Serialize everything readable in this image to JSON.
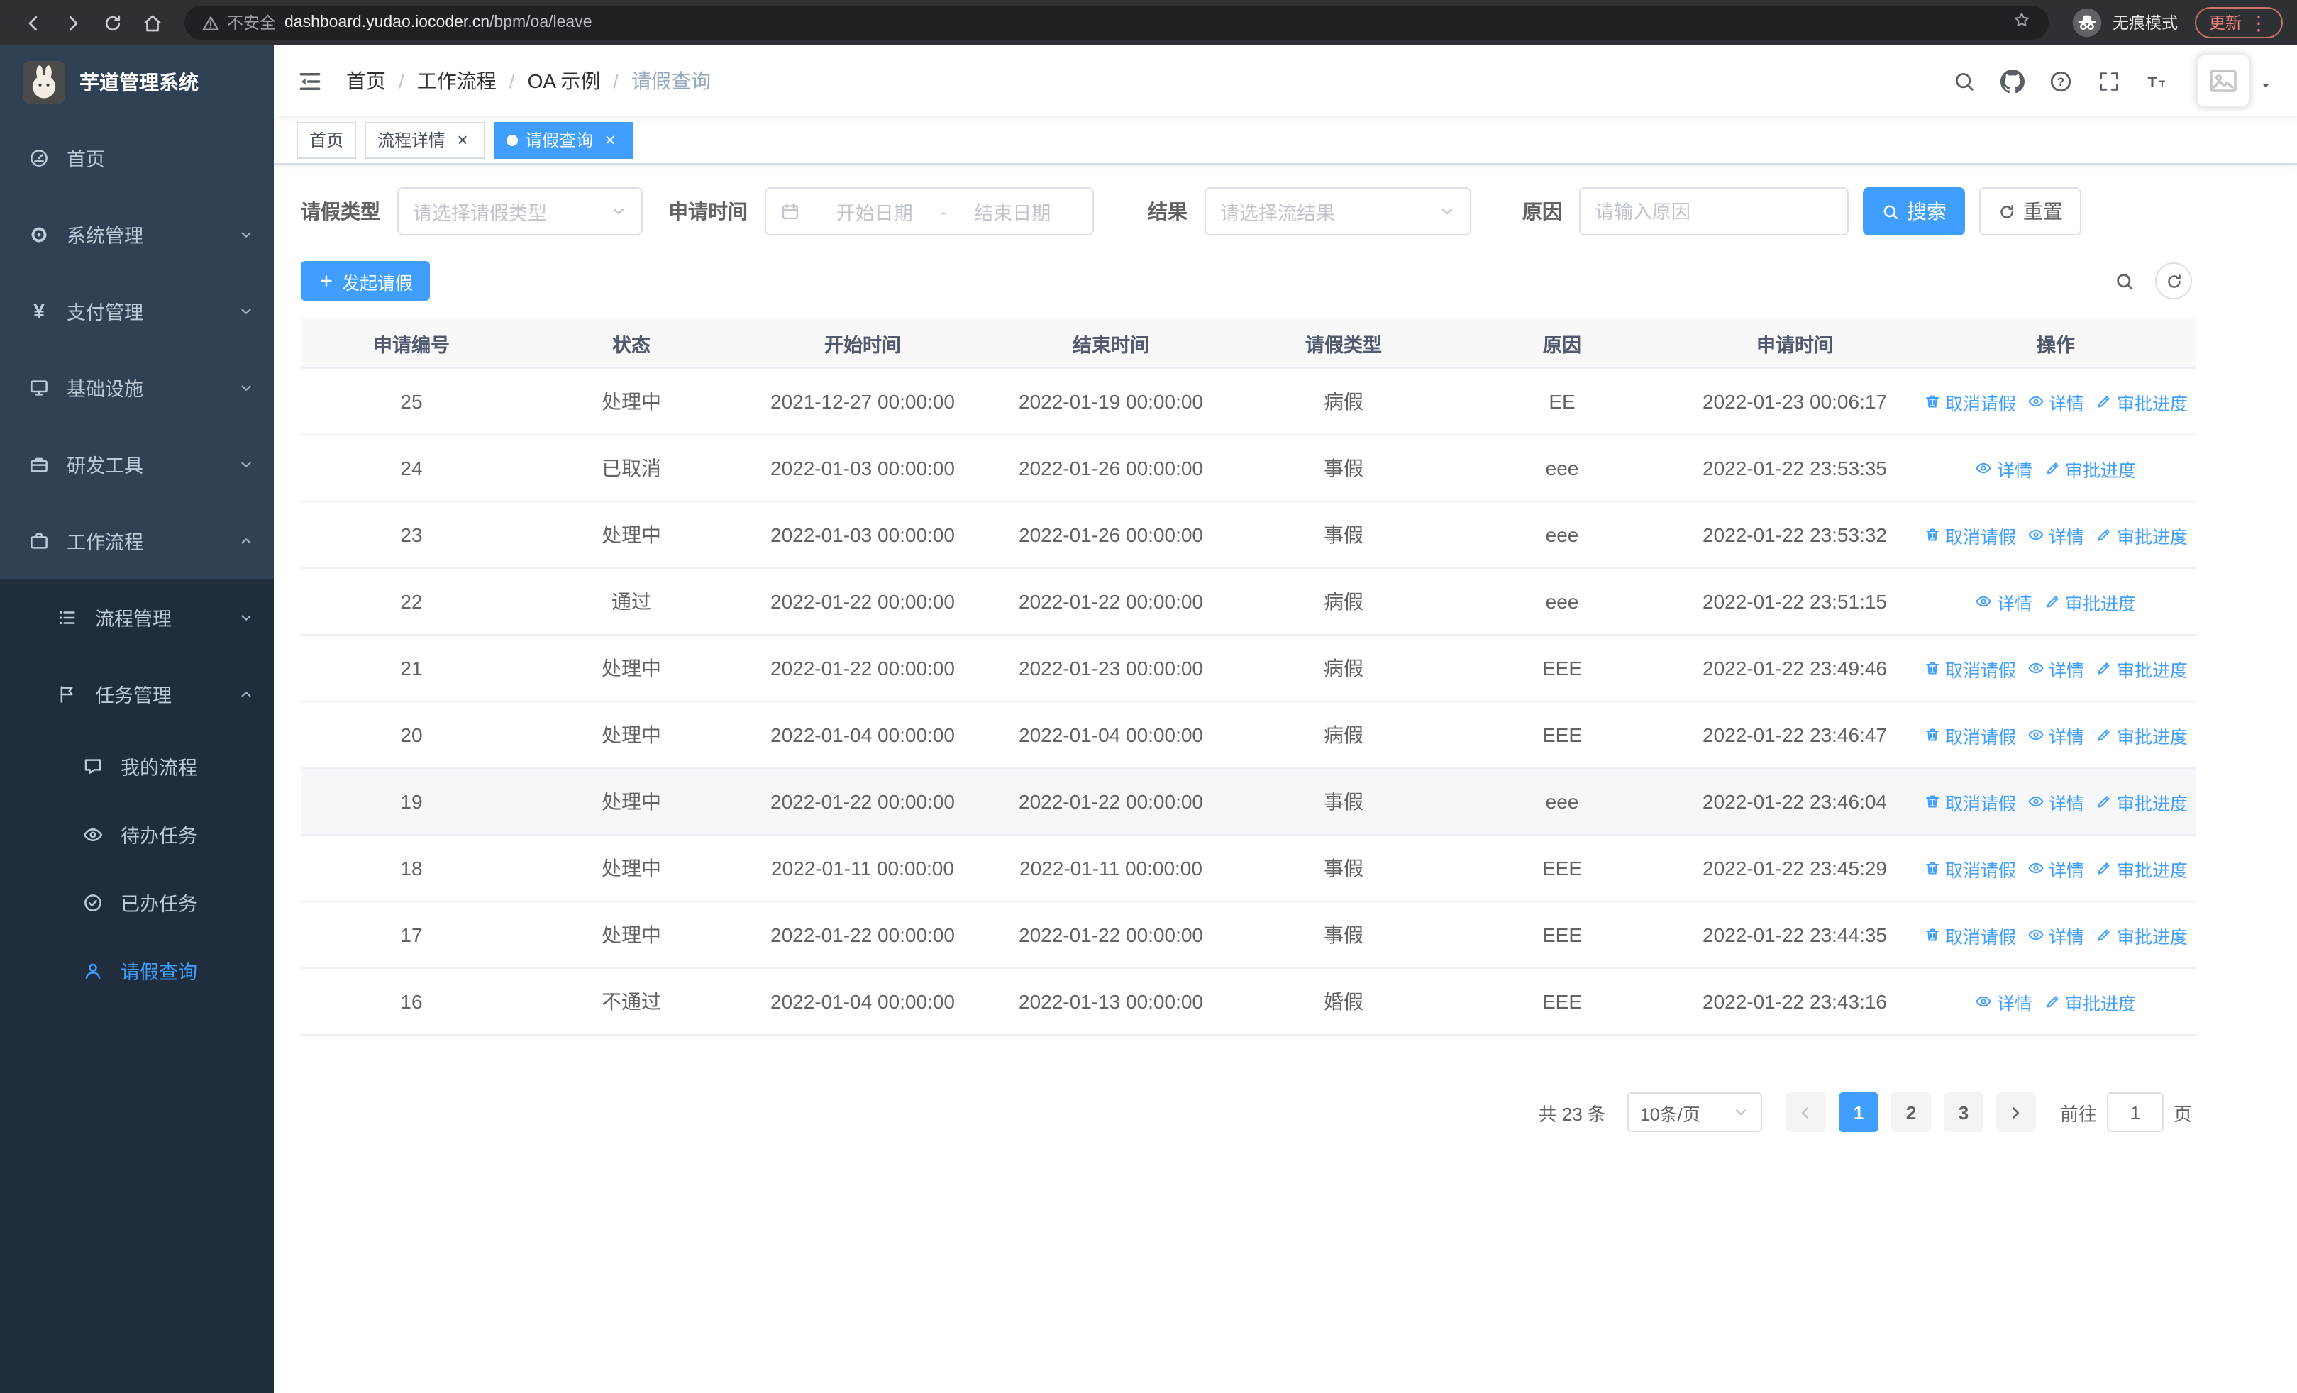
{
  "browser": {
    "security_label": "不安全",
    "url_host": "dashboard.yudao.iocoder.cn",
    "url_path": "/bpm/oa/leave",
    "incognito_label": "无痕模式",
    "update_label": "更新"
  },
  "sidebar": {
    "title": "芋道管理系统",
    "items": [
      {
        "key": "home",
        "label": "首页",
        "icon": "dashboard-icon",
        "level": 1
      },
      {
        "key": "system",
        "label": "系统管理",
        "icon": "gear-icon",
        "level": 1,
        "chevron": "down"
      },
      {
        "key": "payment",
        "label": "支付管理",
        "icon": "yen-icon",
        "level": 1,
        "chevron": "down"
      },
      {
        "key": "infra",
        "label": "基础设施",
        "icon": "monitor-icon",
        "level": 1,
        "chevron": "down"
      },
      {
        "key": "devtools",
        "label": "研发工具",
        "icon": "toolbox-icon",
        "level": 1,
        "chevron": "down"
      },
      {
        "key": "workflow",
        "label": "工作流程",
        "icon": "briefcase-icon",
        "level": 1,
        "chevron": "up",
        "expanded": true
      },
      {
        "key": "process-mgmt",
        "label": "流程管理",
        "icon": "list-icon",
        "level": 2,
        "chevron": "down"
      },
      {
        "key": "task-mgmt",
        "label": "任务管理",
        "icon": "flag-icon",
        "level": 2,
        "chevron": "up",
        "expanded": true
      },
      {
        "key": "my-process",
        "label": "我的流程",
        "icon": "chat-icon",
        "level": 3
      },
      {
        "key": "todo-tasks",
        "label": "待办任务",
        "icon": "eye-icon",
        "level": 3
      },
      {
        "key": "done-tasks",
        "label": "已办任务",
        "icon": "check-circle-icon",
        "level": 3
      },
      {
        "key": "leave-query",
        "label": "请假查询",
        "icon": "user-icon",
        "level": 3,
        "active": true
      }
    ]
  },
  "header": {
    "breadcrumb": [
      "首页",
      "工作流程",
      "OA 示例",
      "请假查询"
    ],
    "separator": "/"
  },
  "tabs": [
    {
      "label": "首页",
      "closable": false,
      "active": false
    },
    {
      "label": "流程详情",
      "closable": true,
      "active": false
    },
    {
      "label": "请假查询",
      "closable": true,
      "active": true
    }
  ],
  "filters": {
    "leave_type_label": "请假类型",
    "leave_type_placeholder": "请选择请假类型",
    "apply_time_label": "申请时间",
    "start_placeholder": "开始日期",
    "range_separator": "-",
    "end_placeholder": "结束日期",
    "result_label": "结果",
    "result_placeholder": "请选择流结果",
    "reason_label": "原因",
    "reason_placeholder": "请输入原因",
    "search_label": "搜索",
    "reset_label": "重置"
  },
  "toolbar": {
    "create_label": "发起请假"
  },
  "table": {
    "columns": [
      "申请编号",
      "状态",
      "开始时间",
      "结束时间",
      "请假类型",
      "原因",
      "申请时间",
      "操作"
    ],
    "rows": [
      {
        "id": "25",
        "status": "处理中",
        "start": "2021-12-27 00:00:00",
        "end": "2022-01-19 00:00:00",
        "type": "病假",
        "reason": "EE",
        "apply_time": "2022-01-23 00:06:17",
        "actions": [
          {
            "label": "取消请假",
            "icon": "delete-icon",
            "name": "cancel-leave-link"
          },
          {
            "label": "详情",
            "icon": "eye-icon",
            "name": "detail-link"
          },
          {
            "label": "审批进度",
            "icon": "edit-icon",
            "name": "audit-progress-link"
          }
        ]
      },
      {
        "id": "24",
        "status": "已取消",
        "start": "2022-01-03 00:00:00",
        "end": "2022-01-26 00:00:00",
        "type": "事假",
        "reason": "eee",
        "apply_time": "2022-01-22 23:53:35",
        "actions": [
          {
            "label": "详情",
            "icon": "eye-icon",
            "name": "detail-link"
          },
          {
            "label": "审批进度",
            "icon": "edit-icon",
            "name": "audit-progress-link"
          }
        ]
      },
      {
        "id": "23",
        "status": "处理中",
        "start": "2022-01-03 00:00:00",
        "end": "2022-01-26 00:00:00",
        "type": "事假",
        "reason": "eee",
        "apply_time": "2022-01-22 23:53:32",
        "actions": [
          {
            "label": "取消请假",
            "icon": "delete-icon",
            "name": "cancel-leave-link"
          },
          {
            "label": "详情",
            "icon": "eye-icon",
            "name": "detail-link"
          },
          {
            "label": "审批进度",
            "icon": "edit-icon",
            "name": "audit-progress-link"
          }
        ]
      },
      {
        "id": "22",
        "status": "通过",
        "start": "2022-01-22 00:00:00",
        "end": "2022-01-22 00:00:00",
        "type": "病假",
        "reason": "eee",
        "apply_time": "2022-01-22 23:51:15",
        "actions": [
          {
            "label": "详情",
            "icon": "eye-icon",
            "name": "detail-link"
          },
          {
            "label": "审批进度",
            "icon": "edit-icon",
            "name": "audit-progress-link"
          }
        ]
      },
      {
        "id": "21",
        "status": "处理中",
        "start": "2022-01-22 00:00:00",
        "end": "2022-01-23 00:00:00",
        "type": "病假",
        "reason": "EEE",
        "apply_time": "2022-01-22 23:49:46",
        "actions": [
          {
            "label": "取消请假",
            "icon": "delete-icon",
            "name": "cancel-leave-link"
          },
          {
            "label": "详情",
            "icon": "eye-icon",
            "name": "detail-link"
          },
          {
            "label": "审批进度",
            "icon": "edit-icon",
            "name": "audit-progress-link"
          }
        ]
      },
      {
        "id": "20",
        "status": "处理中",
        "start": "2022-01-04 00:00:00",
        "end": "2022-01-04 00:00:00",
        "type": "病假",
        "reason": "EEE",
        "apply_time": "2022-01-22 23:46:47",
        "actions": [
          {
            "label": "取消请假",
            "icon": "delete-icon",
            "name": "cancel-leave-link"
          },
          {
            "label": "详情",
            "icon": "eye-icon",
            "name": "detail-link"
          },
          {
            "label": "审批进度",
            "icon": "edit-icon",
            "name": "audit-progress-link"
          }
        ]
      },
      {
        "id": "19",
        "status": "处理中",
        "start": "2022-01-22 00:00:00",
        "end": "2022-01-22 00:00:00",
        "type": "事假",
        "reason": "eee",
        "apply_time": "2022-01-22 23:46:04",
        "highlighted": true,
        "actions": [
          {
            "label": "取消请假",
            "icon": "delete-icon",
            "name": "cancel-leave-link"
          },
          {
            "label": "详情",
            "icon": "eye-icon",
            "name": "detail-link"
          },
          {
            "label": "审批进度",
            "icon": "edit-icon",
            "name": "audit-progress-link"
          }
        ]
      },
      {
        "id": "18",
        "status": "处理中",
        "start": "2022-01-11 00:00:00",
        "end": "2022-01-11 00:00:00",
        "type": "事假",
        "reason": "EEE",
        "apply_time": "2022-01-22 23:45:29",
        "actions": [
          {
            "label": "取消请假",
            "icon": "delete-icon",
            "name": "cancel-leave-link"
          },
          {
            "label": "详情",
            "icon": "eye-icon",
            "name": "detail-link"
          },
          {
            "label": "审批进度",
            "icon": "edit-icon",
            "name": "audit-progress-link"
          }
        ]
      },
      {
        "id": "17",
        "status": "处理中",
        "start": "2022-01-22 00:00:00",
        "end": "2022-01-22 00:00:00",
        "type": "事假",
        "reason": "EEE",
        "apply_time": "2022-01-22 23:44:35",
        "actions": [
          {
            "label": "取消请假",
            "icon": "delete-icon",
            "name": "cancel-leave-link"
          },
          {
            "label": "详情",
            "icon": "eye-icon",
            "name": "detail-link"
          },
          {
            "label": "审批进度",
            "icon": "edit-icon",
            "name": "audit-progress-link"
          }
        ]
      },
      {
        "id": "16",
        "status": "不通过",
        "start": "2022-01-04 00:00:00",
        "end": "2022-01-13 00:00:00",
        "type": "婚假",
        "reason": "EEE",
        "apply_time": "2022-01-22 23:43:16",
        "actions": [
          {
            "label": "详情",
            "icon": "eye-icon",
            "name": "detail-link"
          },
          {
            "label": "审批进度",
            "icon": "edit-icon",
            "name": "audit-progress-link"
          }
        ]
      }
    ]
  },
  "pagination": {
    "total_label": "共 23 条",
    "page_size_value": "10条/页",
    "pages": [
      "1",
      "2",
      "3"
    ],
    "active_page": "1",
    "goto_label": "前往",
    "goto_value": "1",
    "page_unit": "页"
  }
}
